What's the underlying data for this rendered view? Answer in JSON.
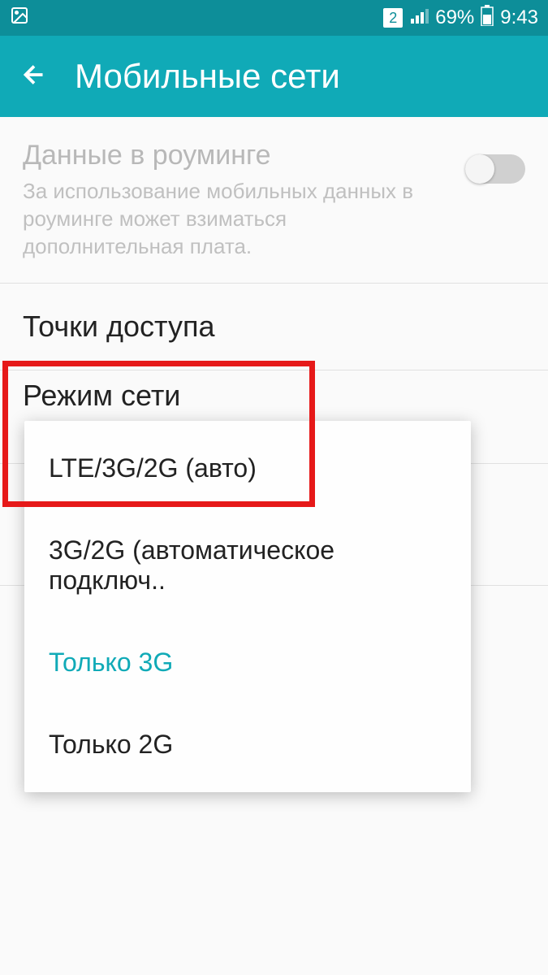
{
  "status_bar": {
    "sim_number": "2",
    "battery_percent": "69%",
    "time": "9:43"
  },
  "app_bar": {
    "title": "Мобильные сети"
  },
  "settings": {
    "roaming": {
      "title": "Данные в роуминге",
      "description": "За использование мобильных данных в роуминге может взиматься дополнительная плата.",
      "enabled": false
    },
    "apn": {
      "title": "Точки доступа"
    },
    "network_mode": {
      "title": "Режим сети"
    }
  },
  "popup": {
    "options": [
      "LTE/3G/2G (авто)",
      "3G/2G (автоматическое подключ..",
      "Только 3G",
      "Только 2G"
    ],
    "selected_index": 2
  },
  "colors": {
    "accent": "#10aab7",
    "status_bg": "#0d8e99",
    "highlight": "#e61919"
  }
}
